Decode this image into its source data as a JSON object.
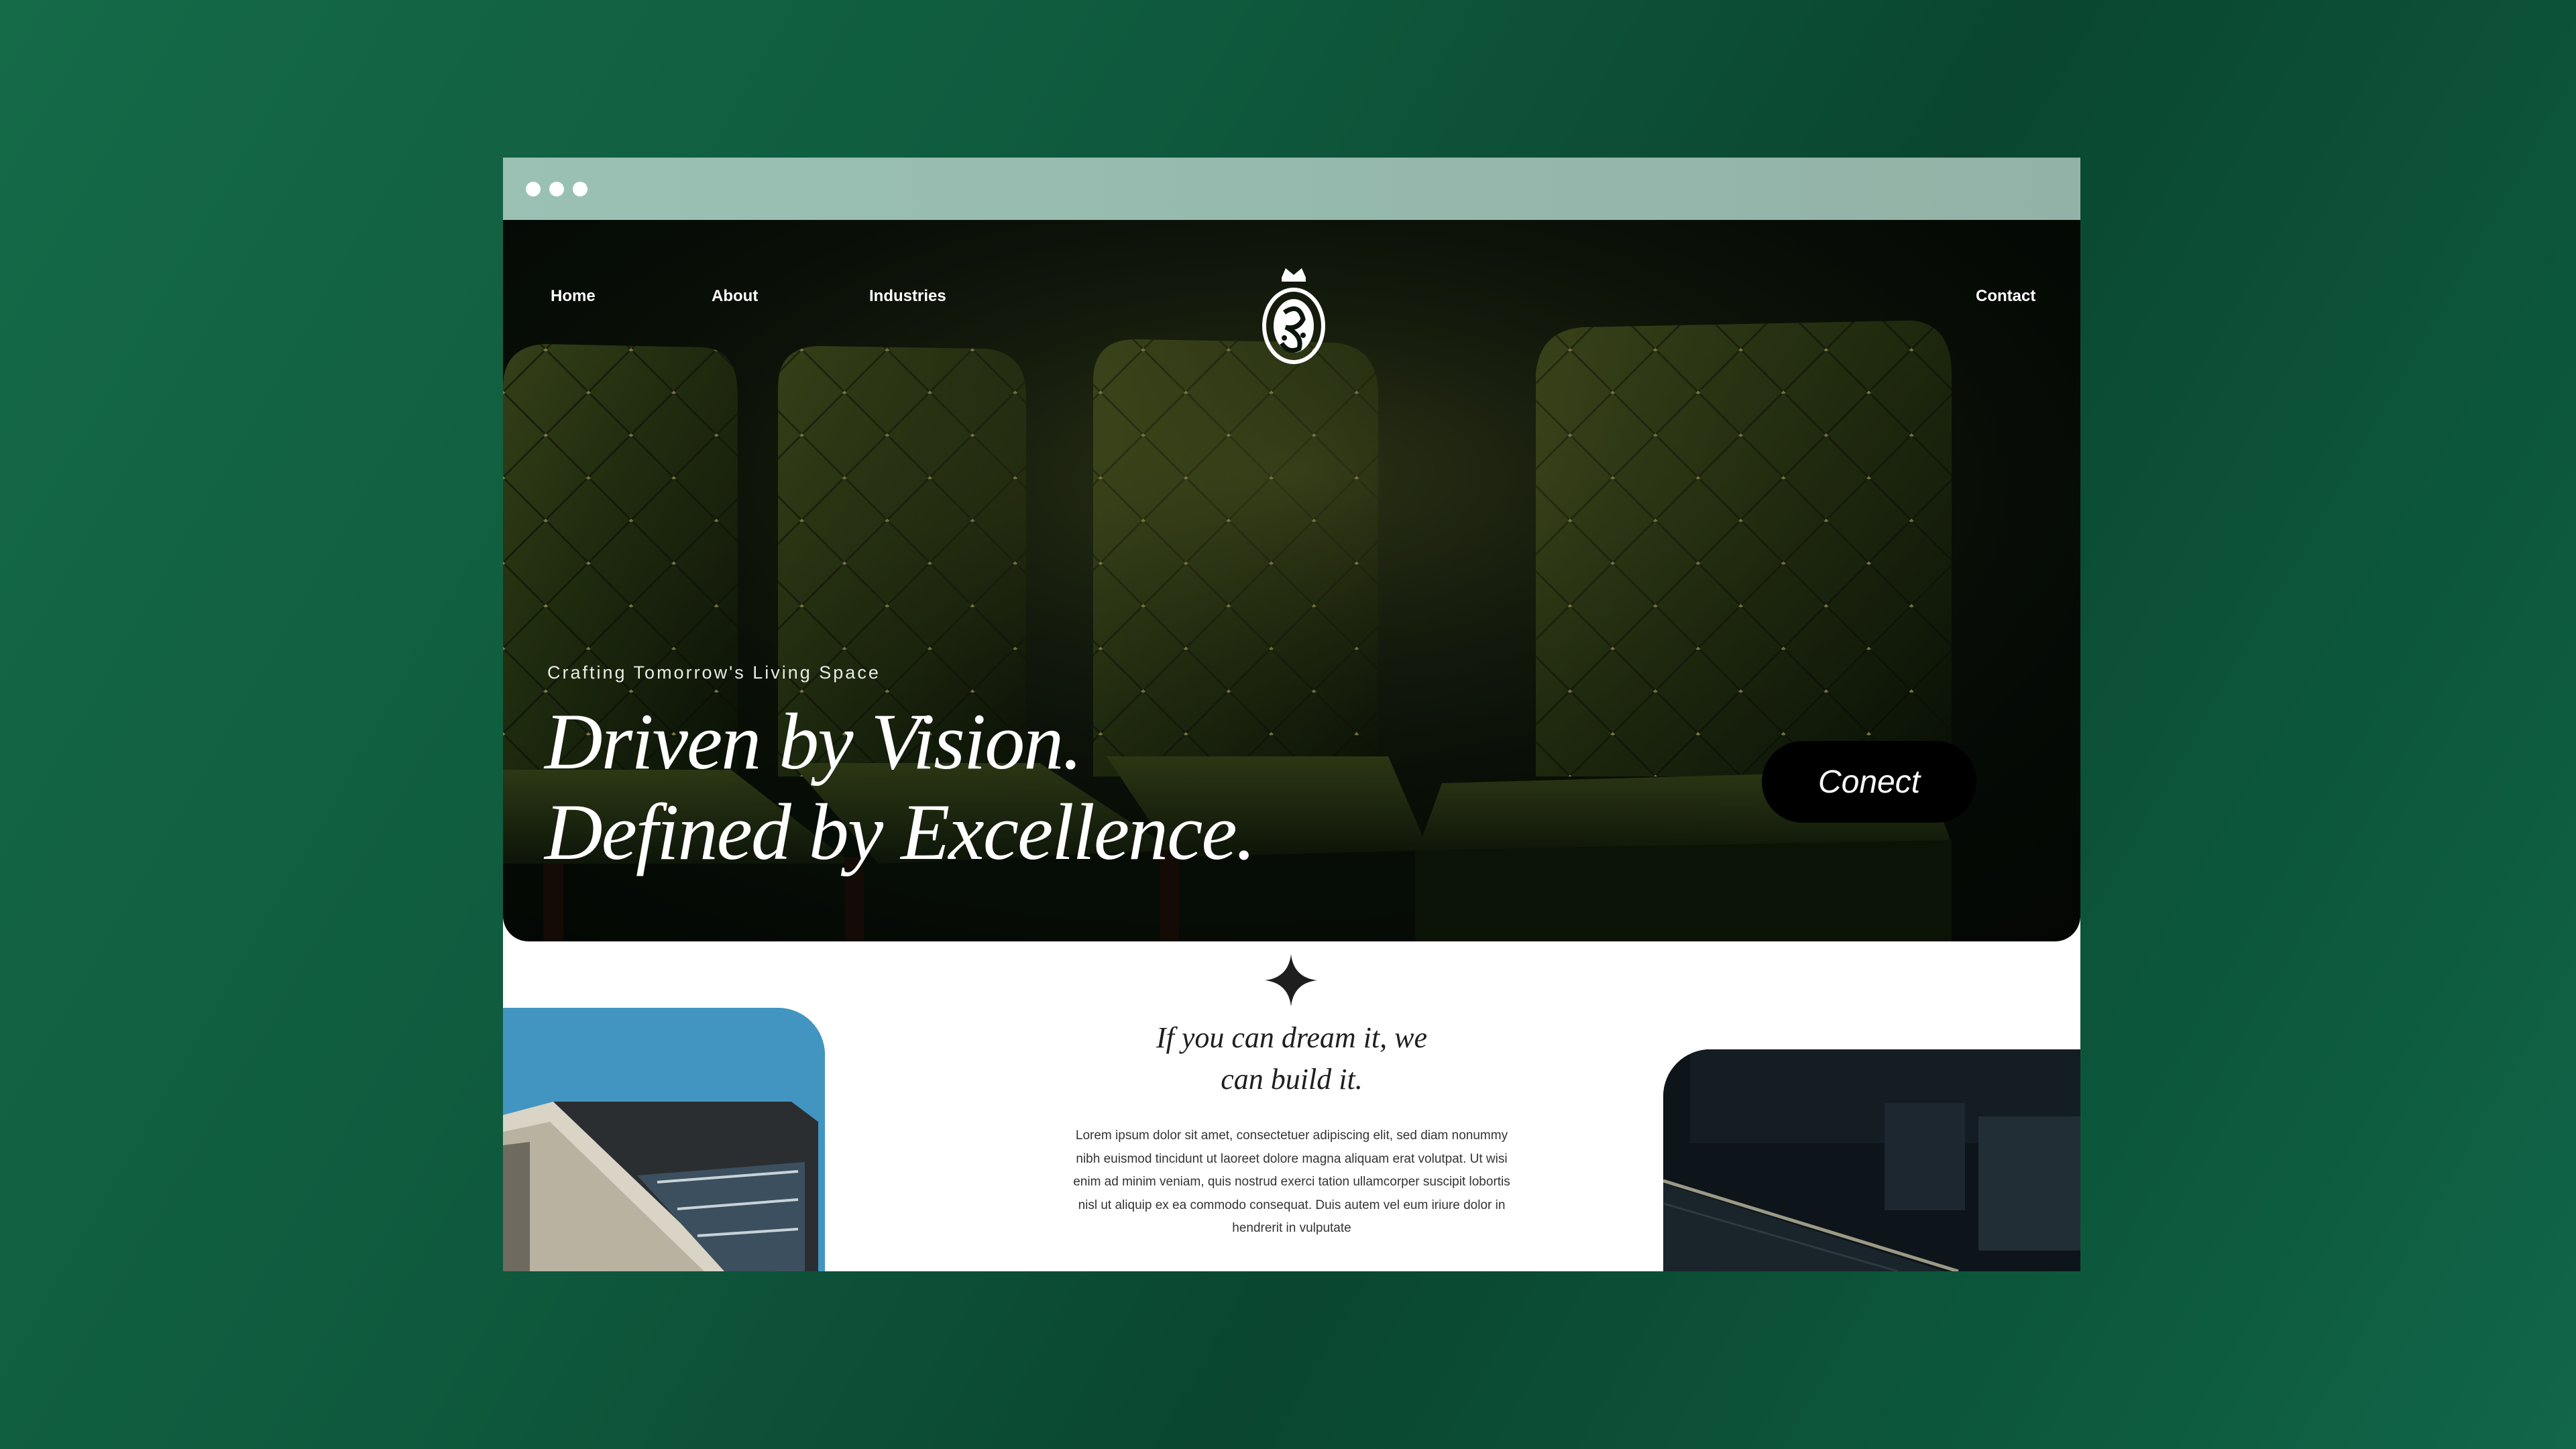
{
  "browser": {
    "dots": [
      "dot",
      "dot",
      "dot"
    ]
  },
  "nav": {
    "home": "Home",
    "about": "About",
    "industries": "Industries",
    "contact": "Contact"
  },
  "hero": {
    "tagline": "Crafting Tomorrow's Living Space",
    "headline_line1": "Driven by Vision.",
    "headline_line2": "Defined by Excellence.",
    "cta_label": "Conect"
  },
  "intro": {
    "quote_line1": "If you can dream it, we",
    "quote_line2": "can build it.",
    "body": "Lorem ipsum dolor sit amet, consectetuer adipiscing elit, sed diam nonummy nibh euismod tincidunt ut laoreet dolore magna aliquam erat volutpat. Ut wisi enim ad minim veniam, quis nostrud exerci tation ullamcorper suscipit lobortis nisl ut aliquip ex ea commodo consequat. Duis autem vel eum iriure dolor in hendrerit in vulputate"
  },
  "colors": {
    "background": "#0f5a3e",
    "titlebar": "#93b2a7",
    "accent_blue": "#4295c0",
    "button": "#000000"
  },
  "icons": {
    "logo": "crest-logo-icon",
    "divider": "four-point-star-icon"
  }
}
